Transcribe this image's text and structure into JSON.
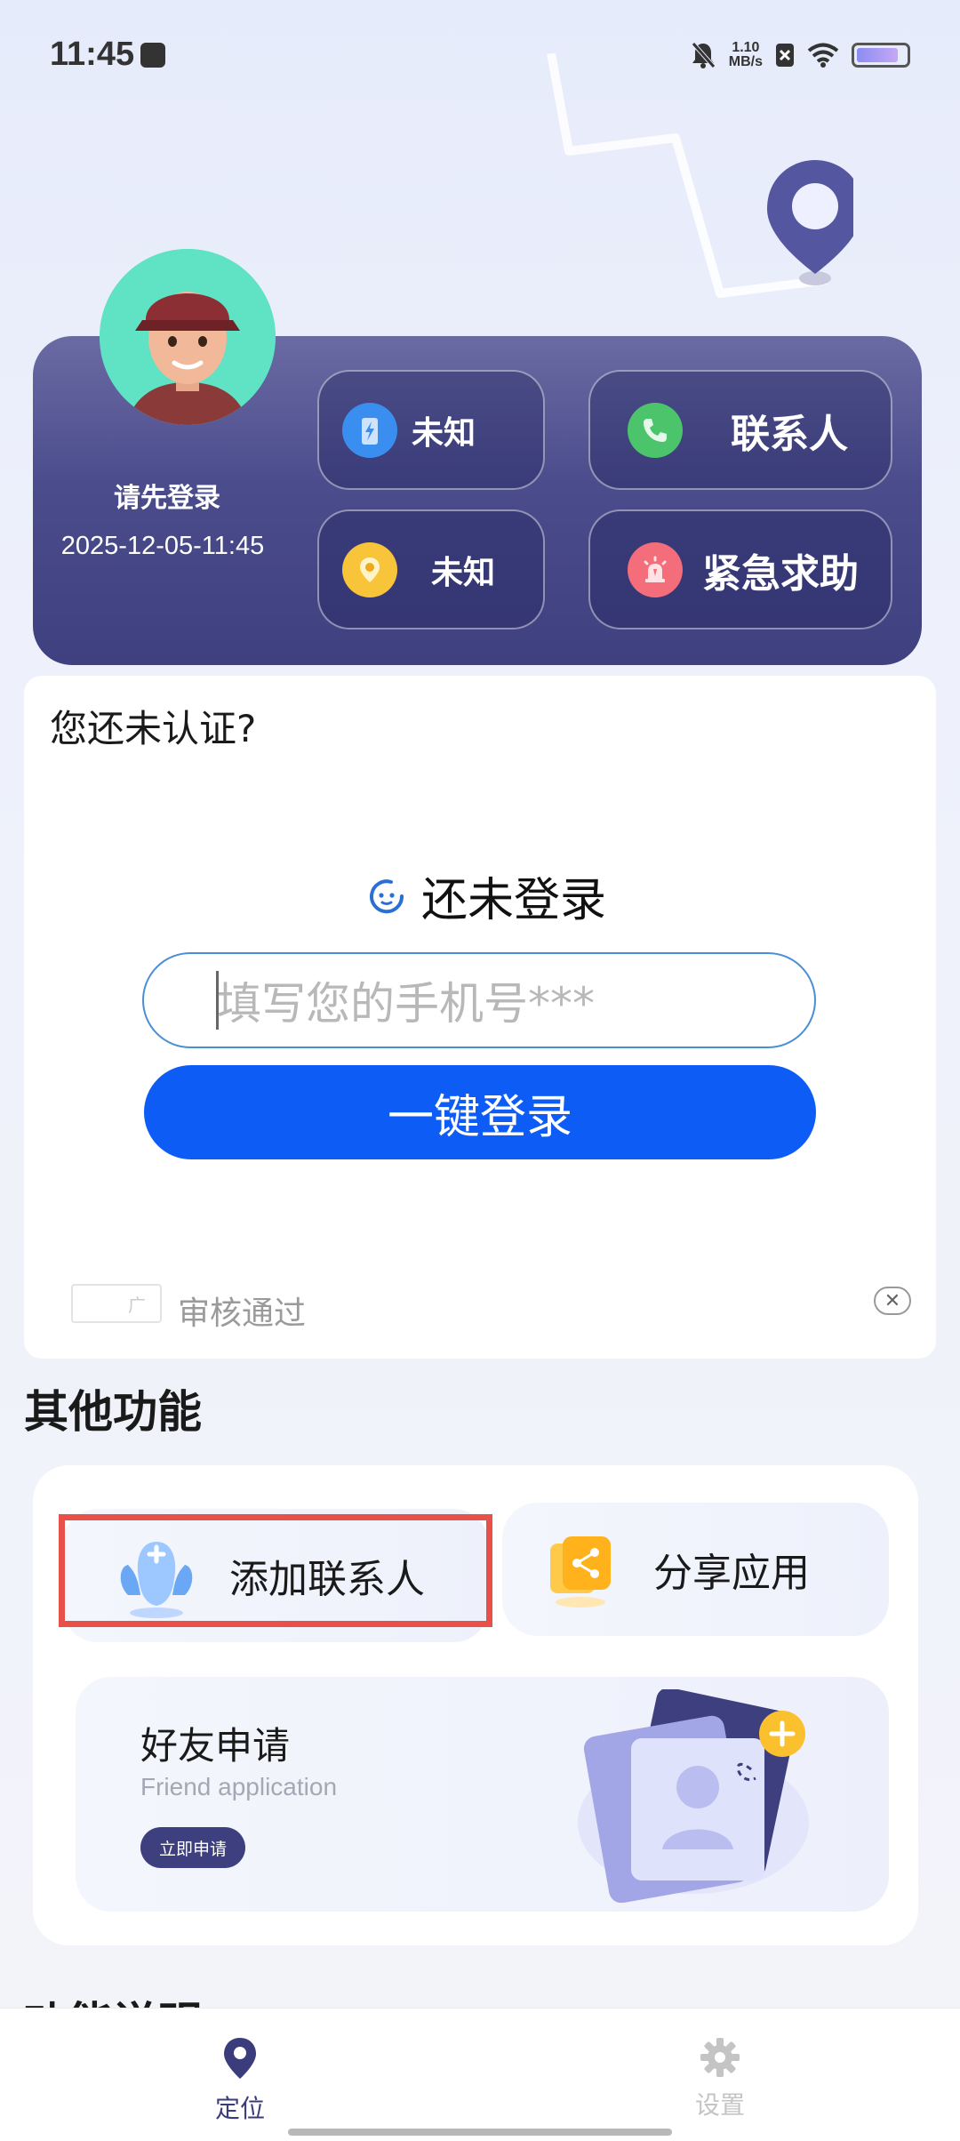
{
  "status_bar": {
    "time": "11:45",
    "speed_value": "1.10",
    "speed_unit": "MB/s"
  },
  "profile": {
    "login_prompt": "请先登录",
    "datetime": "2025-12-05-11:45",
    "battery_status": "未知",
    "location_status": "未知",
    "contacts_label": "联系人",
    "sos_label": "紧急求助"
  },
  "auth": {
    "title": "您还未认证?",
    "not_logged_in": "还未登录",
    "phone_placeholder": "填写您的手机号***",
    "login_button": "一键登录",
    "ad_badge": "广",
    "ad_text": "审核通过"
  },
  "other_features": {
    "section_title": "其他功能",
    "add_contact": "添加联系人",
    "share_app": "分享应用",
    "friend_title": "好友申请",
    "friend_subtitle": "Friend application",
    "apply_button": "立即申请",
    "next_section_title": "功能说明"
  },
  "bottom_nav": {
    "locate": "定位",
    "settings": "设置"
  },
  "colors": {
    "primary": "#0d5cf6",
    "card": "#4b4c8c",
    "highlight": "#e8504a"
  }
}
